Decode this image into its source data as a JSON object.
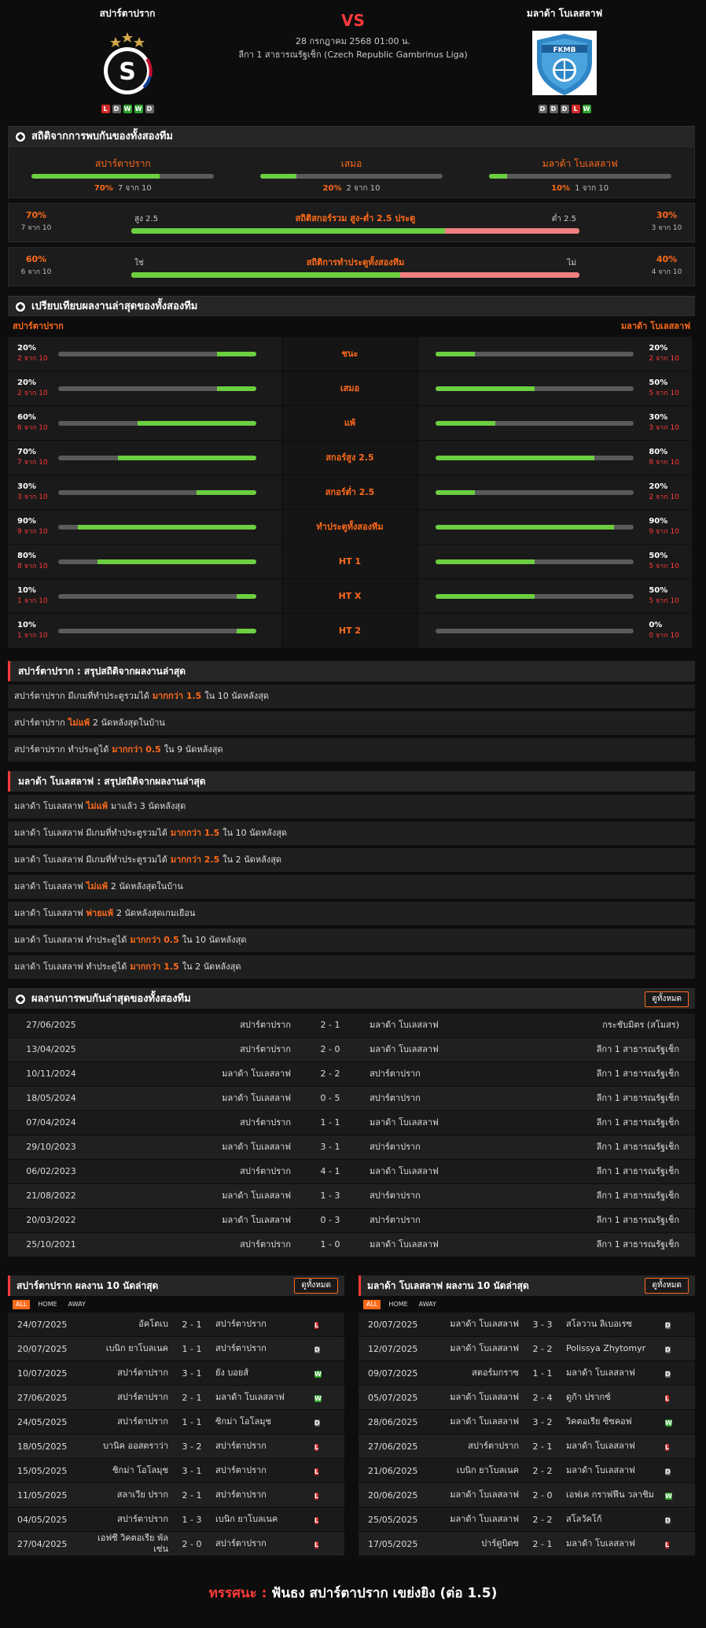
{
  "match": {
    "home": "สปาร์ตาปราก",
    "away": "มลาด้า โบเลสลาฟ",
    "vs": "VS",
    "datetime": "28 กรกฎาคม 2568 01:00 น.",
    "league": "ลีกา 1 สาธารณรัฐเช็ก (Czech Republic Gambrinus Liga)",
    "home_form": [
      "L",
      "D",
      "W",
      "W",
      "D"
    ],
    "away_form": [
      "D",
      "D",
      "D",
      "L",
      "W"
    ]
  },
  "h2h_stats": {
    "title": "สถิติจากการพบกันของทั้งสองทีม",
    "items": [
      {
        "label": "สปาร์ตาปราก",
        "pct": "70%",
        "count": "7 จาก 10",
        "value": 70
      },
      {
        "label": "เสมอ",
        "pct": "20%",
        "count": "2 จาก 10",
        "value": 20
      },
      {
        "label": "มลาด้า โบเลสลาฟ",
        "pct": "10%",
        "count": "1 จาก 10",
        "value": 10
      }
    ],
    "ou": {
      "title": "สถิติสกอร์รวม สูง-ต่ำ 2.5 ประตู",
      "left_label": "สูง 2.5",
      "right_label": "ต่ำ 2.5",
      "left_pct": "70%",
      "left_count": "7 จาก 10",
      "right_pct": "30%",
      "right_count": "3 จาก 10",
      "value": 70
    },
    "btts": {
      "title": "สถิติการทำประตูทั้งสองทีม",
      "left_label": "ใช่",
      "right_label": "ไม่",
      "left_pct": "60%",
      "left_count": "6 จาก 10",
      "right_pct": "40%",
      "right_count": "4 จาก 10",
      "value": 60
    }
  },
  "compare": {
    "title": "เปรียบเทียบผลงานล่าสุดของทั้งสองทีม",
    "home": "สปาร์ตาปราก",
    "away": "มลาด้า โบเลสลาฟ",
    "rows": [
      {
        "label": "ชนะ",
        "hp": "20%",
        "hc": "2 จาก 10",
        "hv": 20,
        "ap": "20%",
        "ac": "2 จาก 10",
        "av": 20
      },
      {
        "label": "เสมอ",
        "hp": "20%",
        "hc": "2 จาก 10",
        "hv": 20,
        "ap": "50%",
        "ac": "5 จาก 10",
        "av": 50
      },
      {
        "label": "แพ้",
        "hp": "60%",
        "hc": "6 จาก 10",
        "hv": 60,
        "ap": "30%",
        "ac": "3 จาก 10",
        "av": 30
      },
      {
        "label": "สกอร์สูง 2.5",
        "hp": "70%",
        "hc": "7 จาก 10",
        "hv": 70,
        "ap": "80%",
        "ac": "8 จาก 10",
        "av": 80
      },
      {
        "label": "สกอร์ต่ำ 2.5",
        "hp": "30%",
        "hc": "3 จาก 10",
        "hv": 30,
        "ap": "20%",
        "ac": "2 จาก 10",
        "av": 20
      },
      {
        "label": "ทำประตูทั้งสองทีม",
        "hp": "90%",
        "hc": "9 จาก 10",
        "hv": 90,
        "ap": "90%",
        "ac": "9 จาก 10",
        "av": 90
      },
      {
        "label": "HT 1",
        "hp": "80%",
        "hc": "8 จาก 10",
        "hv": 80,
        "ap": "50%",
        "ac": "5 จาก 10",
        "av": 50
      },
      {
        "label": "HT X",
        "hp": "10%",
        "hc": "1 จาก 10",
        "hv": 10,
        "ap": "50%",
        "ac": "5 จาก 10",
        "av": 50
      },
      {
        "label": "HT 2",
        "hp": "10%",
        "hc": "1 จาก 10",
        "hv": 10,
        "ap": "0%",
        "ac": "0 จาก 10",
        "av": 0
      }
    ]
  },
  "home_summary": {
    "title": "สปาร์ตาปราก : สรุปสถิติจากผลงานล่าสุด",
    "rows": [
      {
        "a": "สปาร์ตาปราก  มีเกมที่ทำประตูรวมได้",
        "hl": "มากกว่า  1.5",
        "b": "ใน 10 นัดหลังสุด"
      },
      {
        "a": "สปาร์ตาปราก",
        "hl": "ไม่แพ้",
        "b": "2  นัดหลังสุดในบ้าน"
      },
      {
        "a": "สปาร์ตาปราก  ทำประตูได้",
        "hl": "มากกว่า  0.5",
        "b": "ใน 9 นัดหลังสุด"
      }
    ]
  },
  "away_summary": {
    "title": "มลาด้า โบเลสลาฟ : สรุปสถิติจากผลงานล่าสุด",
    "rows": [
      {
        "a": "มลาด้า โบเลสลาฟ",
        "hl": "ไม่แพ้",
        "b": "มาแล้ว 3 นัดหลังสุด"
      },
      {
        "a": "มลาด้า โบเลสลาฟ  มีเกมที่ทำประตูรวมได้",
        "hl": "มากกว่า  1.5",
        "b": "ใน 10 นัดหลังสุด"
      },
      {
        "a": "มลาด้า โบเลสลาฟ  มีเกมที่ทำประตูรวมได้",
        "hl": "มากกว่า  2.5",
        "b": "ใน 2 นัดหลังสุด"
      },
      {
        "a": "มลาด้า โบเลสลาฟ",
        "hl": "ไม่แพ้",
        "b": "2  นัดหลังสุดในบ้าน"
      },
      {
        "a": "มลาด้า โบเลสลาฟ",
        "hl": "พ่ายแพ้",
        "b": "2  นัดหลังสุดเกมเยือน"
      },
      {
        "a": "มลาด้า โบเลสลาฟ  ทำประตูได้",
        "hl": "มากกว่า  0.5",
        "b": "ใน 10 นัดหลังสุด"
      },
      {
        "a": "มลาด้า โบเลสลาฟ  ทำประตูได้",
        "hl": "มากกว่า  1.5",
        "b": "ใน 2 นัดหลังสุด"
      }
    ]
  },
  "h2h_results": {
    "title": "ผลงานการพบกันล่าสุดของทั้งสองทีม",
    "button": "ดูทั้งหมด",
    "rows": [
      {
        "date": "27/06/2025",
        "home": "สปาร์ตาปราก",
        "score": "2 - 1",
        "away": "มลาด้า โบเลสลาฟ",
        "league": "กระชับมิตร (สโมสร)"
      },
      {
        "date": "13/04/2025",
        "home": "สปาร์ตาปราก",
        "score": "2 - 0",
        "away": "มลาด้า โบเลสลาฟ",
        "league": "ลีกา 1 สาธารณรัฐเช็ก"
      },
      {
        "date": "10/11/2024",
        "home": "มลาด้า โบเลสลาฟ",
        "score": "2 - 2",
        "away": "สปาร์ตาปราก",
        "league": "ลีกา 1 สาธารณรัฐเช็ก"
      },
      {
        "date": "18/05/2024",
        "home": "มลาด้า โบเลสลาฟ",
        "score": "0 - 5",
        "away": "สปาร์ตาปราก",
        "league": "ลีกา 1 สาธารณรัฐเช็ก"
      },
      {
        "date": "07/04/2024",
        "home": "สปาร์ตาปราก",
        "score": "1 - 1",
        "away": "มลาด้า โบเลสลาฟ",
        "league": "ลีกา 1 สาธารณรัฐเช็ก"
      },
      {
        "date": "29/10/2023",
        "home": "มลาด้า โบเลสลาฟ",
        "score": "3 - 1",
        "away": "สปาร์ตาปราก",
        "league": "ลีกา 1 สาธารณรัฐเช็ก"
      },
      {
        "date": "06/02/2023",
        "home": "สปาร์ตาปราก",
        "score": "4 - 1",
        "away": "มลาด้า โบเลสลาฟ",
        "league": "ลีกา 1 สาธารณรัฐเช็ก"
      },
      {
        "date": "21/08/2022",
        "home": "มลาด้า โบเลสลาฟ",
        "score": "1 - 3",
        "away": "สปาร์ตาปราก",
        "league": "ลีกา 1 สาธารณรัฐเช็ก"
      },
      {
        "date": "20/03/2022",
        "home": "มลาด้า โบเลสลาฟ",
        "score": "0 - 3",
        "away": "สปาร์ตาปราก",
        "league": "ลีกา 1 สาธารณรัฐเช็ก"
      },
      {
        "date": "25/10/2021",
        "home": "สปาร์ตาปราก",
        "score": "1 - 0",
        "away": "มลาด้า โบเลสลาฟ",
        "league": "ลีกา 1 สาธารณรัฐเช็ก"
      }
    ]
  },
  "home_last10": {
    "title": "สปาร์ตาปราก ผลงาน 10 นัดล่าสุด",
    "button": "ดูทั้งหมด",
    "tabs": [
      "ALL",
      "HOME",
      "AWAY"
    ],
    "rows": [
      {
        "date": "24/07/2025",
        "home": "อัคโตเบ",
        "score": "2 - 1",
        "away": "สปาร์ตาปราก",
        "r": "L"
      },
      {
        "date": "20/07/2025",
        "home": "เบนิก ยาโบลเนค",
        "score": "1 - 1",
        "away": "สปาร์ตาปราก",
        "r": "D"
      },
      {
        "date": "10/07/2025",
        "home": "สปาร์ตาปราก",
        "score": "3 - 1",
        "away": "ยัง บอยส์",
        "r": "W"
      },
      {
        "date": "27/06/2025",
        "home": "สปาร์ตาปราก",
        "score": "2 - 1",
        "away": "มลาด้า โบเลสลาฟ",
        "r": "W"
      },
      {
        "date": "24/05/2025",
        "home": "สปาร์ตาปราก",
        "score": "1 - 1",
        "away": "ซิกม่า โอโลมุช",
        "r": "D"
      },
      {
        "date": "18/05/2025",
        "home": "บานิค ออสตราว่า",
        "score": "3 - 2",
        "away": "สปาร์ตาปราก",
        "r": "L"
      },
      {
        "date": "15/05/2025",
        "home": "ซิกม่า โอโลมุช",
        "score": "3 - 1",
        "away": "สปาร์ตาปราก",
        "r": "L"
      },
      {
        "date": "11/05/2025",
        "home": "สลาเวีย ปราก",
        "score": "2 - 1",
        "away": "สปาร์ตาปราก",
        "r": "L"
      },
      {
        "date": "04/05/2025",
        "home": "สปาร์ตาปราก",
        "score": "1 - 3",
        "away": "เบนิก ยาโบลเนค",
        "r": "L"
      },
      {
        "date": "27/04/2025",
        "home": "เอฟซี วิคตอเรีย พัลเซ่น",
        "score": "2 - 0",
        "away": "สปาร์ตาปราก",
        "r": "L"
      }
    ]
  },
  "away_last10": {
    "title": "มลาด้า โบเลสลาฟ ผลงาน 10 นัดล่าสุด",
    "button": "ดูทั้งหมด",
    "tabs": [
      "ALL",
      "HOME",
      "AWAY"
    ],
    "rows": [
      {
        "date": "20/07/2025",
        "home": "มลาด้า โบเลสลาฟ",
        "score": "3 - 3",
        "away": "สโลวาน ลิเบอเรซ",
        "r": "D"
      },
      {
        "date": "12/07/2025",
        "home": "มลาด้า โบเลสลาฟ",
        "score": "2 - 2",
        "away": "Polissya Zhytomyr",
        "r": "D"
      },
      {
        "date": "09/07/2025",
        "home": "สตอร์มกราซ",
        "score": "1 - 1",
        "away": "มลาด้า โบเลสลาฟ",
        "r": "D"
      },
      {
        "date": "05/07/2025",
        "home": "มลาด้า โบเลสลาฟ",
        "score": "2 - 4",
        "away": "ดูก้า ปรากซ์",
        "r": "L"
      },
      {
        "date": "28/06/2025",
        "home": "มลาด้า โบเลสลาฟ",
        "score": "3 - 2",
        "away": "วิคตอเรีย ซิซคอฟ",
        "r": "W"
      },
      {
        "date": "27/06/2025",
        "home": "สปาร์ตาปราก",
        "score": "2 - 1",
        "away": "มลาด้า โบเลสลาฟ",
        "r": "L"
      },
      {
        "date": "21/06/2025",
        "home": "เบนิก ยาโบลเนค",
        "score": "2 - 2",
        "away": "มลาด้า โบเลสลาฟ",
        "r": "D"
      },
      {
        "date": "20/06/2025",
        "home": "มลาด้า โบเลสลาฟ",
        "score": "2 - 0",
        "away": "เอฟเค กราฟฟีน วลาชิม",
        "r": "W"
      },
      {
        "date": "25/05/2025",
        "home": "มลาด้า โบเลสลาฟ",
        "score": "2 - 2",
        "away": "สโลวัคโก้",
        "r": "D"
      },
      {
        "date": "17/05/2025",
        "home": "ปาร์ดูบิตซ",
        "score": "2 - 1",
        "away": "มลาด้า โบเลสลาฟ",
        "r": "L"
      }
    ]
  },
  "verdict": {
    "label": "ทรรศนะ :",
    "text": "ฟันธง สปาร์ตาปราก เขย่งยิง (ต่อ 1.5)"
  },
  "colors": {
    "accent": "#ff6a1a",
    "red": "#ff3a3a",
    "green": "#6ccf40",
    "win": "#2ea32e",
    "loss": "#d12b2b",
    "draw": "#666666"
  }
}
